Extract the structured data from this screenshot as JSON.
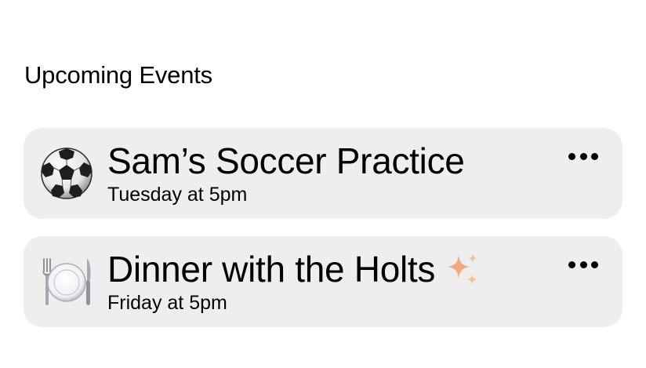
{
  "section": {
    "title": "Upcoming Events"
  },
  "events": [
    {
      "title": "Sam’s Soccer Practice",
      "time": "Tuesday at 5pm",
      "icon": "soccer-ball-icon",
      "has_sparkle": false
    },
    {
      "title": "Dinner with the Holts",
      "time": "Friday at 5pm",
      "icon": "plate-cutlery-icon",
      "has_sparkle": true
    }
  ],
  "colors": {
    "card_background": "#eeeeee",
    "text": "#000000",
    "sparkle": "#f5a97a"
  }
}
